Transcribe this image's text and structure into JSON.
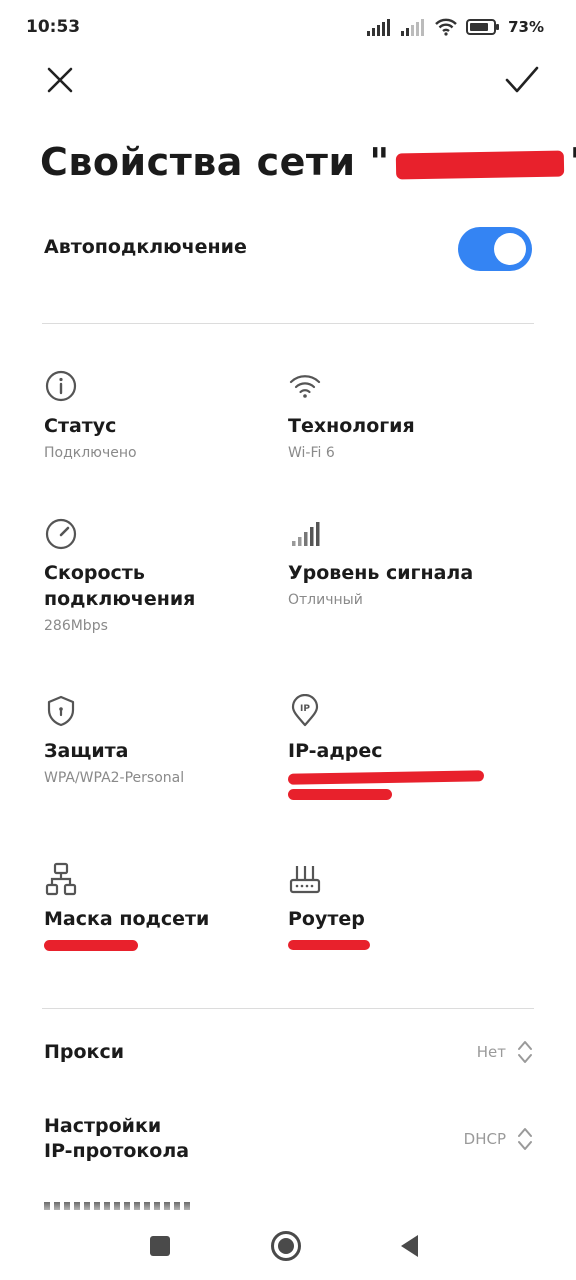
{
  "status_bar": {
    "time": "10:53",
    "battery": "73%"
  },
  "header": {
    "title_prefix": "Свойства сети \"",
    "title_suffix": "\""
  },
  "autoconnect": {
    "label": "Автоподключение",
    "enabled": true
  },
  "details": {
    "status": {
      "label": "Статус",
      "value": "Подключено"
    },
    "technology": {
      "label": "Технология",
      "value": "Wi-Fi 6"
    },
    "speed": {
      "label": "Скорость подключения",
      "value": "286Mbps"
    },
    "signal": {
      "label": "Уровень сигнала",
      "value": "Отличный"
    },
    "security": {
      "label": "Защита",
      "value": "WPA/WPA2-Personal"
    },
    "ip": {
      "label": "IP-адрес"
    },
    "subnet": {
      "label": "Маска подсети"
    },
    "router": {
      "label": "Роутер"
    }
  },
  "settings": {
    "proxy": {
      "label": "Прокси",
      "value": "Нет"
    },
    "ip_settings": {
      "label_line1": "Настройки",
      "label_line2": "IP-протокола",
      "value": "DHCP"
    }
  },
  "colors": {
    "accent": "#3484f3",
    "redaction": "#e8212c"
  }
}
